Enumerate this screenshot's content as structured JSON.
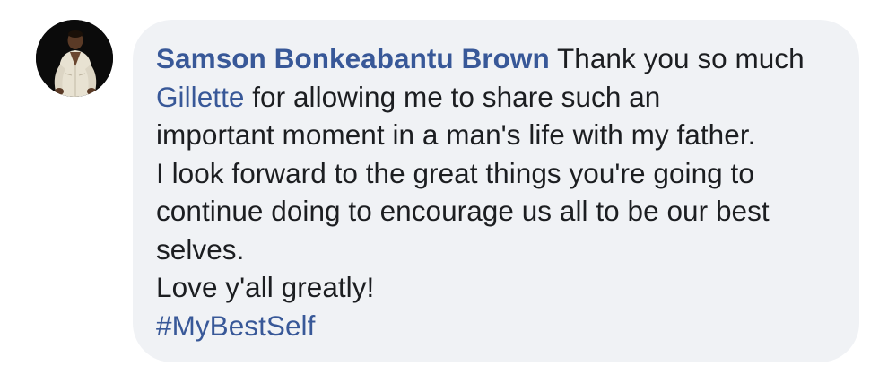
{
  "comment": {
    "author": "Samson Bonkeabantu Brown",
    "line1_after_author": " Thank you so much",
    "mention": "Gillette",
    "line2_after_mention": " for allowing me to share such an",
    "line3": "important moment in a man's life with my father.",
    "line4": "I look forward to the great things you're going to",
    "line5": "continue doing to encourage us all to be our best",
    "line6": "selves.",
    "line7": "Love y'all greatly!",
    "hashtag": "#MyBestSelf"
  },
  "colors": {
    "link": "#385898",
    "bubble_background": "#f0f2f5",
    "text": "#1c1e21"
  },
  "icons": {
    "avatar": "user-profile-photo"
  }
}
